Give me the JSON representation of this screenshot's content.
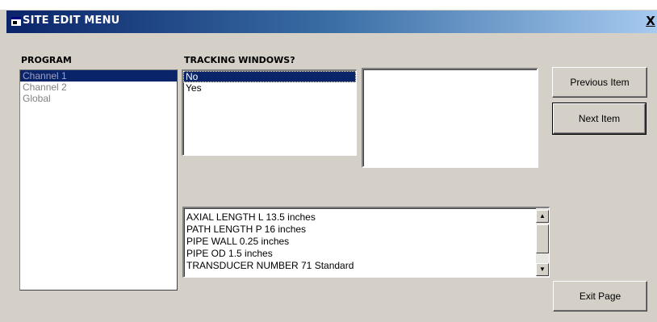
{
  "window": {
    "title": "SITE EDIT MENU",
    "close_label": "X"
  },
  "program": {
    "label": "PROGRAM",
    "items": [
      {
        "label": "Channel 1",
        "selected": true
      },
      {
        "label": "Channel 2",
        "selected": false
      },
      {
        "label": "Global",
        "selected": false
      }
    ]
  },
  "tracking": {
    "label": "TRACKING WINDOWS?",
    "items": [
      {
        "label": "No",
        "selected": true
      },
      {
        "label": "Yes",
        "selected": false
      }
    ]
  },
  "summary": {
    "lines": [
      "AXIAL LENGTH L  13.5 inches",
      "PATH LENGTH P  16 inches",
      "PIPE WALL  0.25 inches",
      "PIPE OD  1.5 inches",
      "TRANSDUCER NUMBER  71 Standard"
    ]
  },
  "buttons": {
    "previous": "Previous Item",
    "next": "Next Item",
    "exit": "Exit Page"
  },
  "icons": {
    "app": "window-app-icon",
    "close": "close-icon",
    "scroll_up": "scroll-up-icon",
    "scroll_down": "scroll-down-icon"
  }
}
